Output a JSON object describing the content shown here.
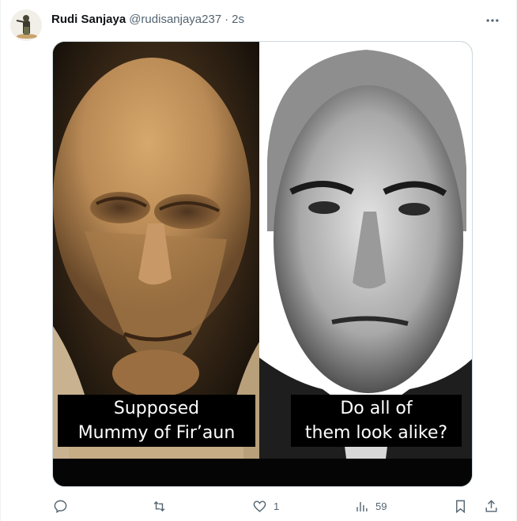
{
  "author": {
    "display_name": "Rudi Sanjaya",
    "handle": "@rudisanjaya237",
    "separator": "·",
    "time": "2s"
  },
  "media": {
    "left_caption_lines": [
      "Supposed",
      "Mummy of Fir’aun"
    ],
    "right_caption_lines": [
      "Do all of",
      "them look alike?"
    ]
  },
  "actions": {
    "reply_count": "",
    "retweet_count": "",
    "like_count": "1",
    "views_count": "59"
  },
  "colors": {
    "text_primary": "#0f1419",
    "text_secondary": "#536471",
    "border": "#cfd9de"
  },
  "icons": [
    "more-icon",
    "reply-icon",
    "retweet-icon",
    "like-icon",
    "views-icon",
    "bookmark-icon",
    "share-icon"
  ]
}
